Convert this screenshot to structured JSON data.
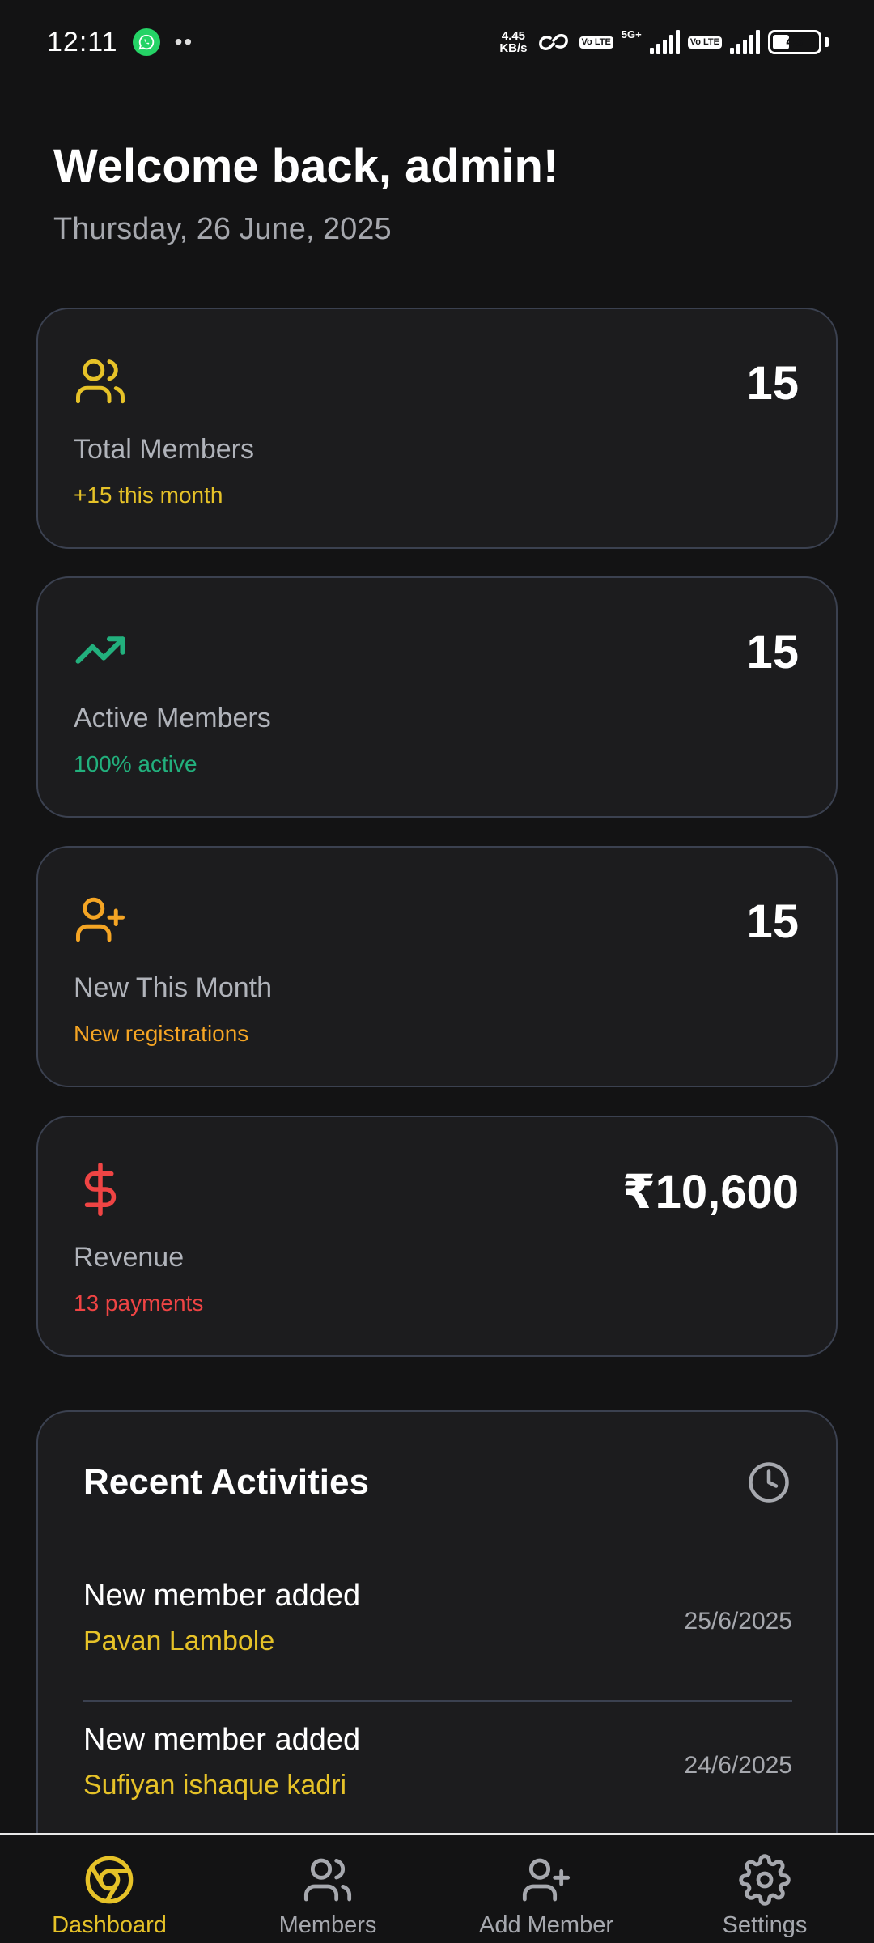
{
  "status_bar": {
    "time": "12:11",
    "more_indicator": "••",
    "net_speed_value": "4.45",
    "net_speed_unit": "KB/s",
    "volte": "Vo LTE",
    "network_type": "5G+",
    "battery": "43",
    "battery_level": 0.43
  },
  "header": {
    "welcome": "Welcome back, admin!",
    "date": "Thursday, 26 June, 2025"
  },
  "stats": [
    {
      "icon": "users-icon",
      "value": "15",
      "label": "Total Members",
      "sub": "+15 this month",
      "accent": "#e6c228"
    },
    {
      "icon": "trending-up-icon",
      "value": "15",
      "label": "Active Members",
      "sub": "100% active",
      "accent": "#22b07d"
    },
    {
      "icon": "user-plus-icon",
      "value": "15",
      "label": "New This Month",
      "sub": "New registrations",
      "accent": "#f5a524"
    },
    {
      "icon": "dollar-sign-icon",
      "value": "₹10,600",
      "label": "Revenue",
      "sub": "13 payments",
      "accent": "#ef4444"
    }
  ],
  "activities": {
    "title": "Recent Activities",
    "icon": "clock-icon",
    "items": [
      {
        "text": "New member added",
        "name": "Pavan Lambole",
        "date": "25/6/2025"
      },
      {
        "text": "New member added",
        "name": "Sufiyan ishaque kadri",
        "date": "24/6/2025"
      }
    ]
  },
  "nav": {
    "items": [
      {
        "label": "Dashboard",
        "icon": "dashboard-icon",
        "active": true
      },
      {
        "label": "Members",
        "icon": "users-icon",
        "active": false
      },
      {
        "label": "Add Member",
        "icon": "user-plus-icon",
        "active": false
      },
      {
        "label": "Settings",
        "icon": "gear-icon",
        "active": false
      }
    ]
  },
  "colors": {
    "background": "#131314",
    "card": "#1c1c1e",
    "border": "#3b4150",
    "accent": "#e6c228"
  }
}
